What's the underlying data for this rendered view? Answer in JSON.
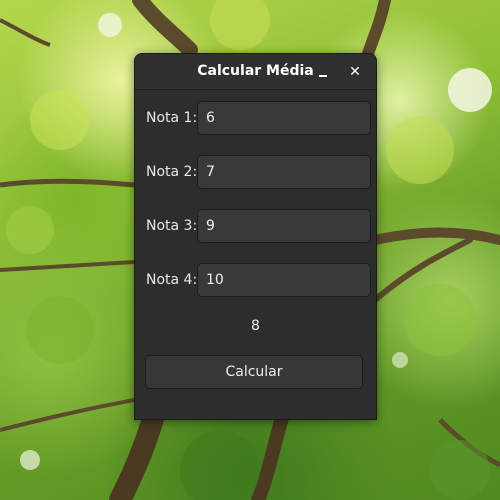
{
  "window": {
    "title": "Calcular Média",
    "minimize_icon": "minimize-icon",
    "close_icon": "close-icon",
    "close_glyph": "✕"
  },
  "form": {
    "fields": [
      {
        "label": "Nota 1:",
        "value": "6"
      },
      {
        "label": "Nota 2:",
        "value": "7"
      },
      {
        "label": "Nota 3:",
        "value": "9"
      },
      {
        "label": "Nota 4:",
        "value": "10"
      }
    ],
    "result": "8",
    "button_label": "Calcular"
  },
  "colors": {
    "window_bg": "#2d2d2d",
    "input_bg": "#393939",
    "text": "#f0f0f0"
  }
}
